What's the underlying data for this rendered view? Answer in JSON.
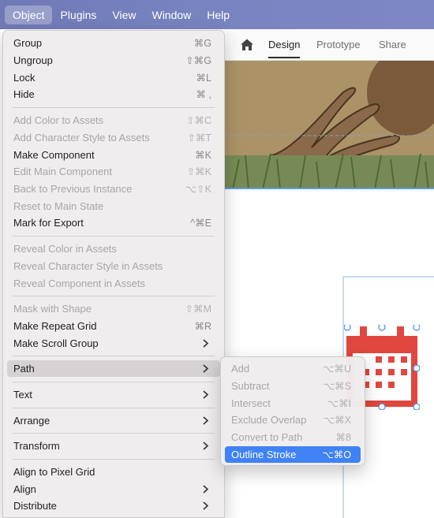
{
  "menubar": {
    "items": [
      "Object",
      "Plugins",
      "View",
      "Window",
      "Help"
    ]
  },
  "toolbar": {
    "tabs": [
      "Design",
      "Prototype",
      "Share"
    ]
  },
  "object_menu": {
    "items": [
      {
        "label": "Group",
        "shortcut": "⌘G",
        "enabled": true
      },
      {
        "label": "Ungroup",
        "shortcut": "⇧⌘G",
        "enabled": true
      },
      {
        "label": "Lock",
        "shortcut": "⌘L",
        "enabled": true
      },
      {
        "label": "Hide",
        "shortcut": "⌘ ,",
        "enabled": true
      },
      {
        "label": "Add Color to Assets",
        "shortcut": "⇧⌘C",
        "enabled": false
      },
      {
        "label": "Add Character Style to Assets",
        "shortcut": "⇧⌘T",
        "enabled": false
      },
      {
        "label": "Make Component",
        "shortcut": "⌘K",
        "enabled": true
      },
      {
        "label": "Edit Main Component",
        "shortcut": "⇧⌘K",
        "enabled": false
      },
      {
        "label": "Back to Previous Instance",
        "shortcut": "⌥⇧K",
        "enabled": false
      },
      {
        "label": "Reset to Main State",
        "shortcut": "",
        "enabled": false
      },
      {
        "label": "Mark for Export",
        "shortcut": "^⌘E",
        "enabled": true
      },
      {
        "label": "Reveal Color in Assets",
        "shortcut": "",
        "enabled": false
      },
      {
        "label": "Reveal Character Style in Assets",
        "shortcut": "",
        "enabled": false
      },
      {
        "label": "Reveal Component in Assets",
        "shortcut": "",
        "enabled": false
      },
      {
        "label": "Mask with Shape",
        "shortcut": "⇧⌘M",
        "enabled": false
      },
      {
        "label": "Make Repeat Grid",
        "shortcut": "⌘R",
        "enabled": true
      },
      {
        "label": "Make Scroll Group",
        "shortcut": "",
        "enabled": true
      },
      {
        "label": "Path",
        "shortcut": "",
        "enabled": true
      },
      {
        "label": "Text",
        "shortcut": "",
        "enabled": true
      },
      {
        "label": "Arrange",
        "shortcut": "",
        "enabled": true
      },
      {
        "label": "Transform",
        "shortcut": "",
        "enabled": true
      },
      {
        "label": "Align to Pixel Grid",
        "shortcut": "",
        "enabled": true
      },
      {
        "label": "Align",
        "shortcut": "",
        "enabled": true
      },
      {
        "label": "Distribute",
        "shortcut": "",
        "enabled": true
      }
    ]
  },
  "path_submenu": {
    "items": [
      {
        "label": "Add",
        "shortcut": "⌥⌘U",
        "enabled": false
      },
      {
        "label": "Subtract",
        "shortcut": "⌥⌘S",
        "enabled": false
      },
      {
        "label": "Intersect",
        "shortcut": "⌥⌘I",
        "enabled": false
      },
      {
        "label": "Exclude Overlap",
        "shortcut": "⌥⌘X",
        "enabled": false
      },
      {
        "label": "Convert to Path",
        "shortcut": "⌘8",
        "enabled": false
      },
      {
        "label": "Outline Stroke",
        "shortcut": "⌥⌘O",
        "enabled": true
      }
    ]
  },
  "colors": {
    "selection": "#3f82f5",
    "calendar_icon": "#e0483f"
  }
}
